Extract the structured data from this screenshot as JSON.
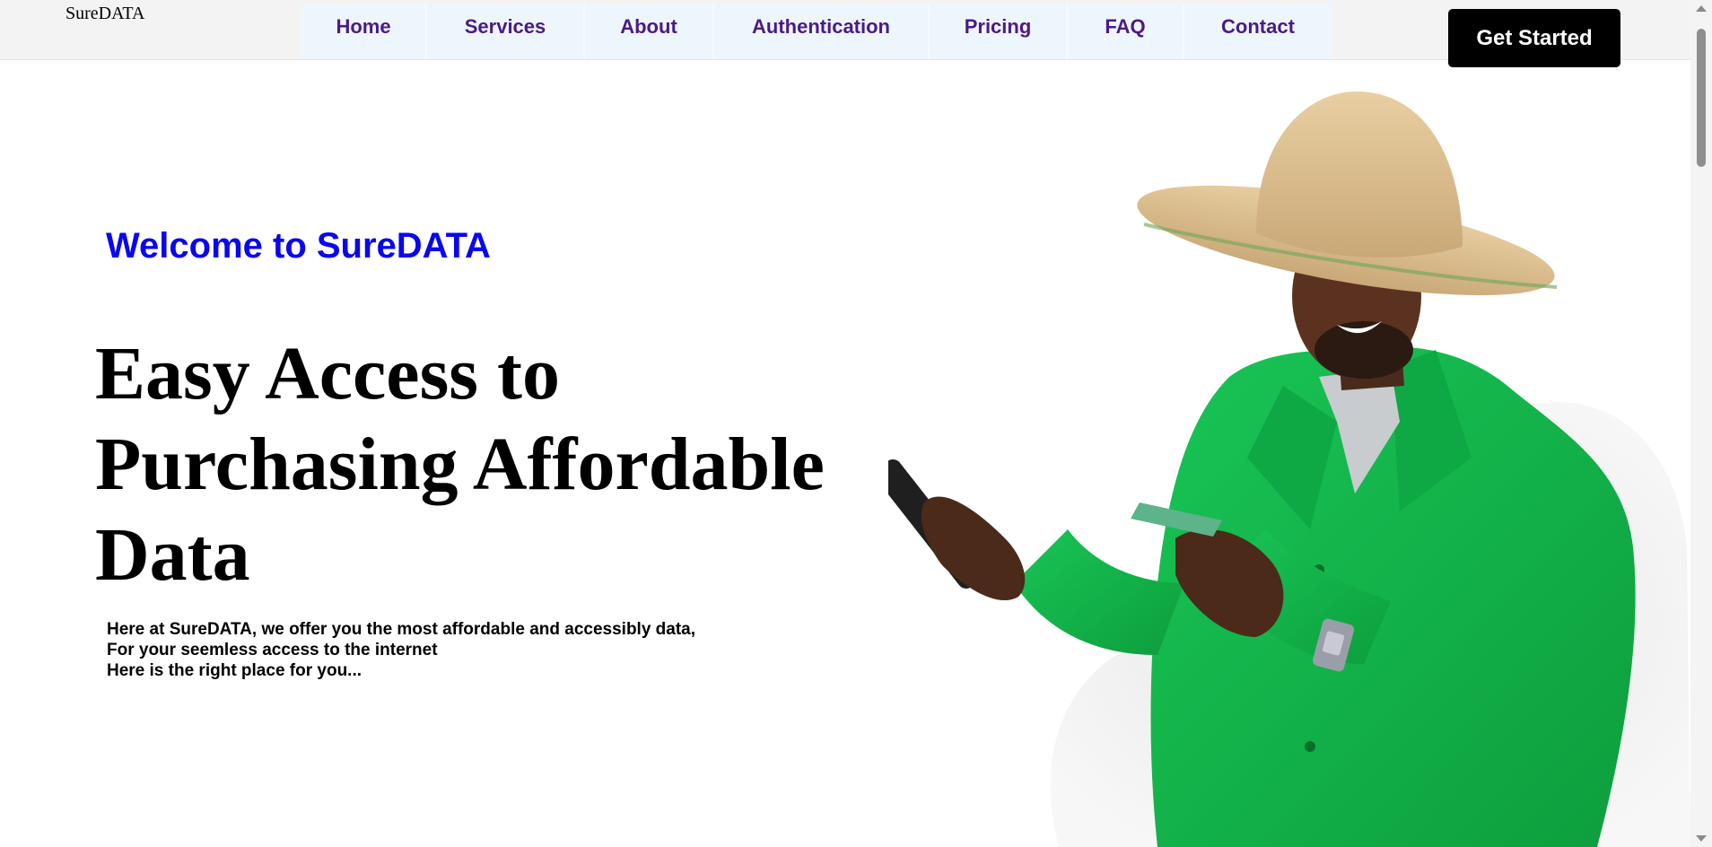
{
  "brand": {
    "name": "SureDATA"
  },
  "nav": {
    "items": [
      {
        "label": "Home"
      },
      {
        "label": "Services"
      },
      {
        "label": "About"
      },
      {
        "label": "Authentication"
      },
      {
        "label": "Pricing"
      },
      {
        "label": "FAQ"
      },
      {
        "label": "Contact"
      }
    ]
  },
  "cta": {
    "label": "Get Started"
  },
  "hero": {
    "welcome": "Welcome to SureDATA",
    "headline": "Easy Access to Purchasing Affordable Data",
    "lines": [
      "Here at SureDATA, we offer you the most affordable and accessibly data,",
      "For your seemless access to the internet",
      "Here is the right place for you..."
    ]
  },
  "colors": {
    "accent": "#0a06ee",
    "nav_text": "#4b1a86",
    "cta_bg": "#000000",
    "jacket_green": "#12b84a"
  },
  "icons": [
    "scroll-up-arrow-icon",
    "scroll-down-arrow-icon"
  ]
}
